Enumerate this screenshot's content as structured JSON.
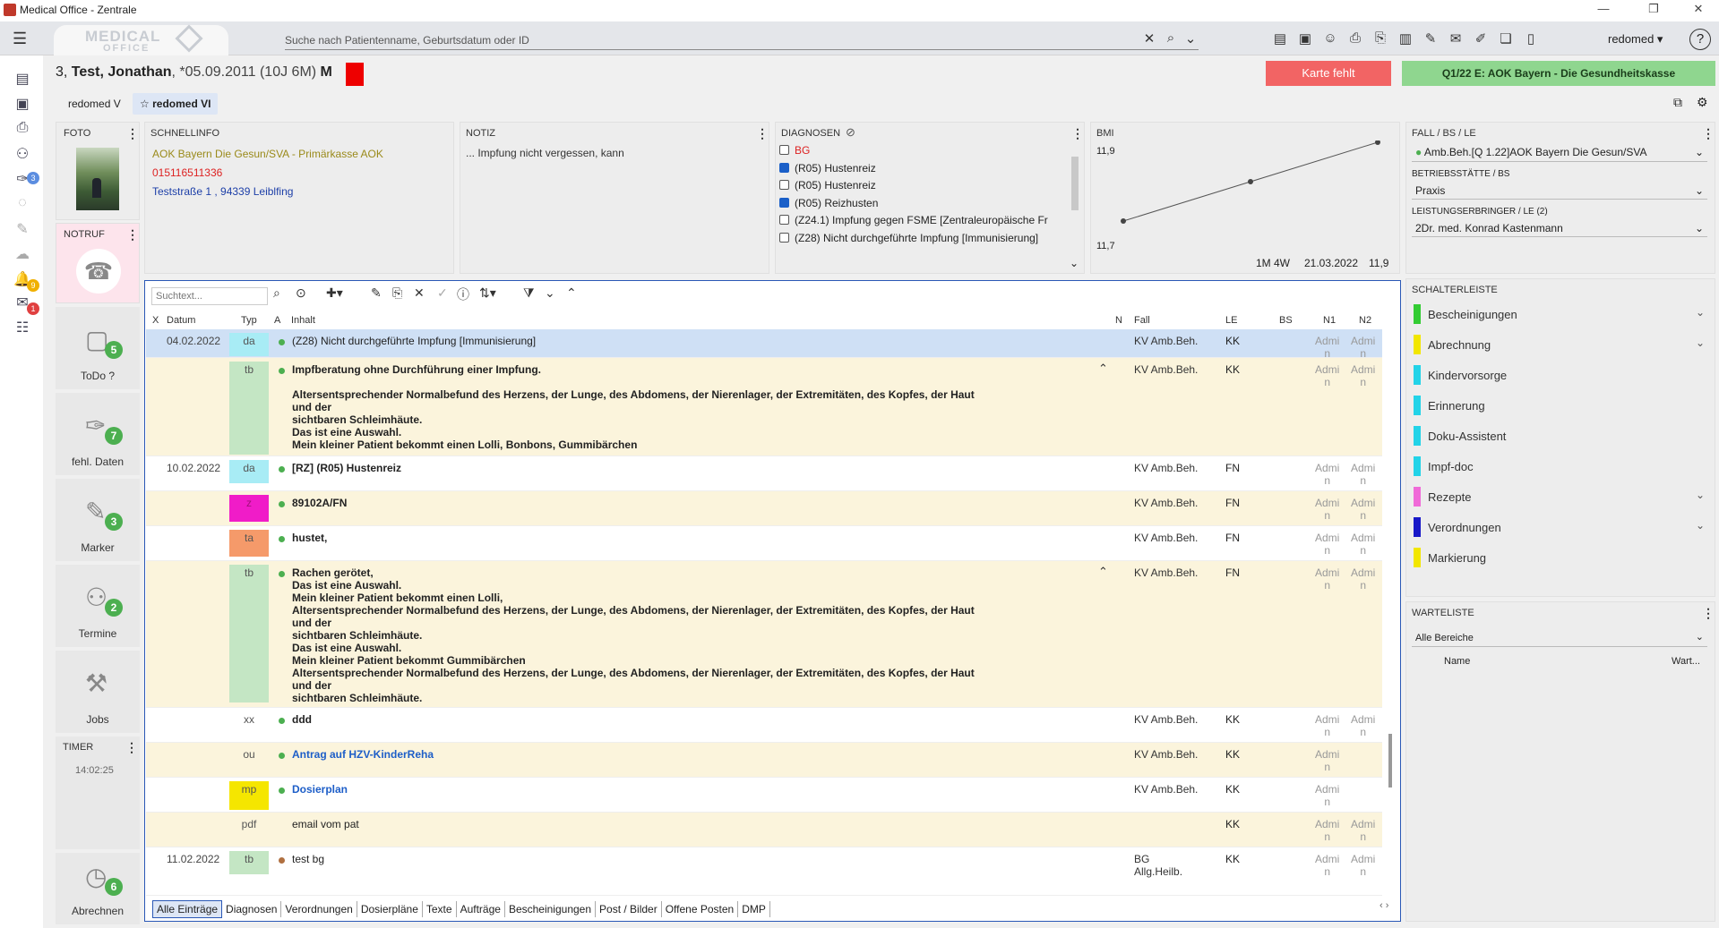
{
  "window": {
    "title": "Medical Office - Zentrale"
  },
  "topbar": {
    "logo_text": "MEDICAL",
    "logo_sub": "OFFICE",
    "search_placeholder": "Suche nach Patientenname, Geburtsdatum oder ID",
    "user": "redomed ▾",
    "help": "?"
  },
  "patient": {
    "number": "3,",
    "name": "Test, Jonathan",
    "birth": ", *05.09.2011 (10J 6M)",
    "sex": "M"
  },
  "header_buttons": {
    "karte": "Karte fehlt",
    "insurance": "Q1/22 E: AOK Bayern - Die Gesundheitskasse"
  },
  "tabs": [
    "redomed V",
    "redomed VI"
  ],
  "foto": {
    "title": "FOTO"
  },
  "notruf": {
    "title": "NOTRUF"
  },
  "schnellinfo": {
    "title": "SCHNELLINFO",
    "insurance": "AOK Bayern Die Gesun/SVA - Primärkasse AOK",
    "phone": "015116511336",
    "address": "Teststraße 1 , 94339 Leiblfing"
  },
  "notiz": {
    "title": "NOTIZ",
    "text": "... Impfung nicht vergessen, kann"
  },
  "diagnosen": {
    "title": "DIAGNOSEN",
    "items": [
      {
        "label": "BG",
        "checked": false,
        "red": true
      },
      {
        "label": "(R05) Hustenreiz",
        "checked": true
      },
      {
        "label": "(R05) Hustenreiz",
        "checked": false
      },
      {
        "label": "(R05) Reizhusten",
        "checked": true
      },
      {
        "label": "(Z24.1) Impfung gegen FSME [Zentraleuropäische Fr",
        "checked": false
      },
      {
        "label": "(Z28) Nicht durchgeführte Impfung [Immunisierung]",
        "checked": false
      }
    ]
  },
  "bmi": {
    "title": "BMI",
    "y_max": "11,9",
    "y_min": "11,7",
    "foot_period": "1M 4W",
    "foot_date": "21.03.2022",
    "foot_value": "11,9"
  },
  "chart_data": {
    "type": "line",
    "title": "BMI",
    "ylim": [
      11.7,
      11.9
    ],
    "values": [
      11.7,
      11.8,
      11.9
    ]
  },
  "fall": {
    "title": "FALL / BS / LE",
    "fall_value": "Amb.Beh.[Q 1.22]AOK Bayern Die Gesun/SVA",
    "bs_label": "BETRIEBSSTÄTTE / BS",
    "bs_value": "Praxis",
    "le_label": "LEISTUNGSERBRINGER / LE (2)",
    "le_value": "2Dr. med. Konrad Kastenmann"
  },
  "sidecards": [
    {
      "label": "ToDo ?",
      "badge": "5"
    },
    {
      "label": "fehl. Daten",
      "badge": "7"
    },
    {
      "label": "Marker",
      "badge": "3"
    },
    {
      "label": "Termine",
      "badge": "2"
    },
    {
      "label": "Jobs",
      "badge": ""
    },
    {
      "label": "Abrechnen",
      "badge": "6"
    }
  ],
  "timer": {
    "title": "TIMER",
    "time": "14:02:25"
  },
  "rail_badges": {
    "b1": "3",
    "b2": "9",
    "b3": "1"
  },
  "journal": {
    "search_placeholder": "Suchtext...",
    "columns": {
      "x": "X",
      "datum": "Datum",
      "typ": "Typ",
      "a": "A",
      "inhalt": "Inhalt",
      "n": "N",
      "fall": "Fall",
      "le": "LE",
      "bs": "BS",
      "n1": "N1",
      "n2": "N2"
    },
    "rows": [
      {
        "date": "04.02.2022",
        "typ": "da",
        "content": "(Z28) Nicht durchgeführte Impfung [Immunisierung]",
        "fall": "KV Amb.Beh.",
        "le": "KK",
        "n1": "Admi\nn",
        "n2": "Admi\nn"
      },
      {
        "date": "",
        "typ": "tb",
        "content": "Impfberatung ohne Durchführung einer Impfung.\n\nAltersentsprechender Normalbefund des Herzens, der Lunge, des Abdomens, der Nierenlager, der Extremitäten, des Kopfes, der Haut und der\nsichtbaren Schleimhäute.\nDas ist eine Auswahl.\nMein kleiner Patient bekommt einen Lolli, Bonbons, Gummibärchen",
        "fall": "KV Amb.Beh.",
        "le": "KK",
        "n1": "Admi\nn",
        "n2": "Admi\nn"
      },
      {
        "date": "10.02.2022",
        "typ": "da",
        "content": "[RZ] (R05) Hustenreiz",
        "fall": "KV Amb.Beh.",
        "le": "FN",
        "n1": "Admi\nn",
        "n2": "Admi\nn"
      },
      {
        "date": "",
        "typ": "z",
        "content": "89102A/FN",
        "fall": "KV Amb.Beh.",
        "le": "FN",
        "n1": "Admi\nn",
        "n2": "Admi\nn"
      },
      {
        "date": "",
        "typ": "ta",
        "content": "hustet,",
        "fall": "KV Amb.Beh.",
        "le": "FN",
        "n1": "Admi\nn",
        "n2": "Admi\nn"
      },
      {
        "date": "",
        "typ": "tb",
        "content": "Rachen gerötet,\nDas ist eine Auswahl.\nMein kleiner Patient bekommt einen Lolli,\nAltersentsprechender Normalbefund des Herzens, der Lunge, des Abdomens, der Nierenlager, der Extremitäten, des Kopfes, der Haut und der\nsichtbaren Schleimhäute.\nDas ist eine Auswahl.\nMein kleiner Patient bekommt Gummibärchen\nAltersentsprechender Normalbefund des Herzens, der Lunge, des Abdomens, der Nierenlager, der Extremitäten, des Kopfes, der Haut und der\nsichtbaren Schleimhäute.",
        "fall": "KV Amb.Beh.",
        "le": "FN",
        "n1": "Admi\nn",
        "n2": "Admi\nn"
      },
      {
        "date": "",
        "typ": "xx",
        "content": "ddd",
        "fall": "KV Amb.Beh.",
        "le": "KK",
        "n1": "Admi\nn",
        "n2": "Admi\nn"
      },
      {
        "date": "",
        "typ": "ou",
        "content": "Antrag auf HZV-KinderReha",
        "fall": "KV Amb.Beh.",
        "le": "KK",
        "n1": "Admi\nn",
        "n2": ""
      },
      {
        "date": "",
        "typ": "mp",
        "content": "Dosierplan",
        "fall": "KV Amb.Beh.",
        "le": "KK",
        "n1": "Admi\nn",
        "n2": ""
      },
      {
        "date": "",
        "typ": "pdf",
        "content": "email vom pat",
        "fall": "",
        "le": "KK",
        "n1": "Admi\nn",
        "n2": "Admi\nn"
      },
      {
        "date": "11.02.2022",
        "typ": "tb",
        "content": "test bg",
        "fall": "BG\nAllg.Heilb.",
        "le": "KK",
        "n1": "Admi\nn",
        "n2": "Admi\nn"
      }
    ],
    "bottom_tabs": [
      "Alle Einträge",
      "Diagnosen",
      "Verordnungen",
      "Dosierpläne",
      "Texte",
      "Aufträge",
      "Bescheinigungen",
      "Post / Bilder",
      "Offene Posten",
      "DMP"
    ]
  },
  "schalterleiste": {
    "title": "SCHALTERLEISTE",
    "items": [
      {
        "label": "Bescheinigungen",
        "color": "#33cc33",
        "chevron": true
      },
      {
        "label": "Abrechnung",
        "color": "#f2e600",
        "chevron": true
      },
      {
        "label": "Kindervorsorge",
        "color": "#22d3e8",
        "chevron": false
      },
      {
        "label": "Erinnerung",
        "color": "#22d3e8",
        "chevron": false
      },
      {
        "label": "Doku-Assistent",
        "color": "#22d3e8",
        "chevron": false
      },
      {
        "label": "Impf-doc",
        "color": "#22d3e8",
        "chevron": false
      },
      {
        "label": "Rezepte",
        "color": "#f06ad8",
        "chevron": true
      },
      {
        "label": "Verordnungen",
        "color": "#1818c8",
        "chevron": true
      },
      {
        "label": "Markierung",
        "color": "#f2e600",
        "chevron": false
      }
    ]
  },
  "warteliste": {
    "title": "WARTELISTE",
    "filter": "Alle Bereiche",
    "col_name": "Name",
    "col_wart": "Wart..."
  }
}
